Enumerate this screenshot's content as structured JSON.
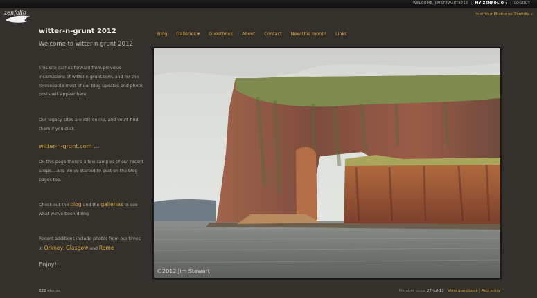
{
  "topbar": {
    "welcome": "WELCOME, JIMSTEWART8716",
    "my_zenfolio": "MY ZENFOLIO",
    "logout": "LOGOUT",
    "sep": "|"
  },
  "logo": {
    "text": "zenfolio"
  },
  "host_link": "Host Your Photos on Zenfolio »",
  "site": {
    "title": "witter-n-grunt 2012"
  },
  "nav": {
    "items": [
      "Blog",
      "Galleries ▾",
      "Guestbook",
      "About",
      "Contact",
      "New this month",
      "Links"
    ]
  },
  "sidebar": {
    "welcome": "Welcome to witter-n-grunt 2012",
    "para1": "This site carries forward from previous incarnations of witter-n-grunt.com, and for the foreseeable most of our blog updates and photo posts will appear here.",
    "para2": "Our legacy sites are still online, and you'll find them if you click",
    "legacy_link": "witter-n-grunt.com ...",
    "para3": "On this page there's a few samples of our recent snaps....and we've started to post on the blog pages too.",
    "para4_pre": "Check out the ",
    "blog_link": "blog",
    "para4_mid": " and the ",
    "galleries_link": "galleries",
    "para4_post": " to see what we've been doing",
    "para5_pre": "Recent additions include photos from our times in ",
    "orkney_link": "Orkney",
    "comma": ", ",
    "glasgow_link": "Glasgow",
    "and_text": " and ",
    "rome_link": "Rome",
    "enjoy": "Enjoy!!"
  },
  "photo": {
    "copyright": "©2012 Jim Stewart"
  },
  "footer": {
    "photo_count": "222",
    "photos_label": "photos",
    "member_since_label": "Member since",
    "member_since_date": "27-Jul-12",
    "view_guestbook": "View guestbook",
    "add_entry": "Add entry",
    "sep": "|"
  }
}
